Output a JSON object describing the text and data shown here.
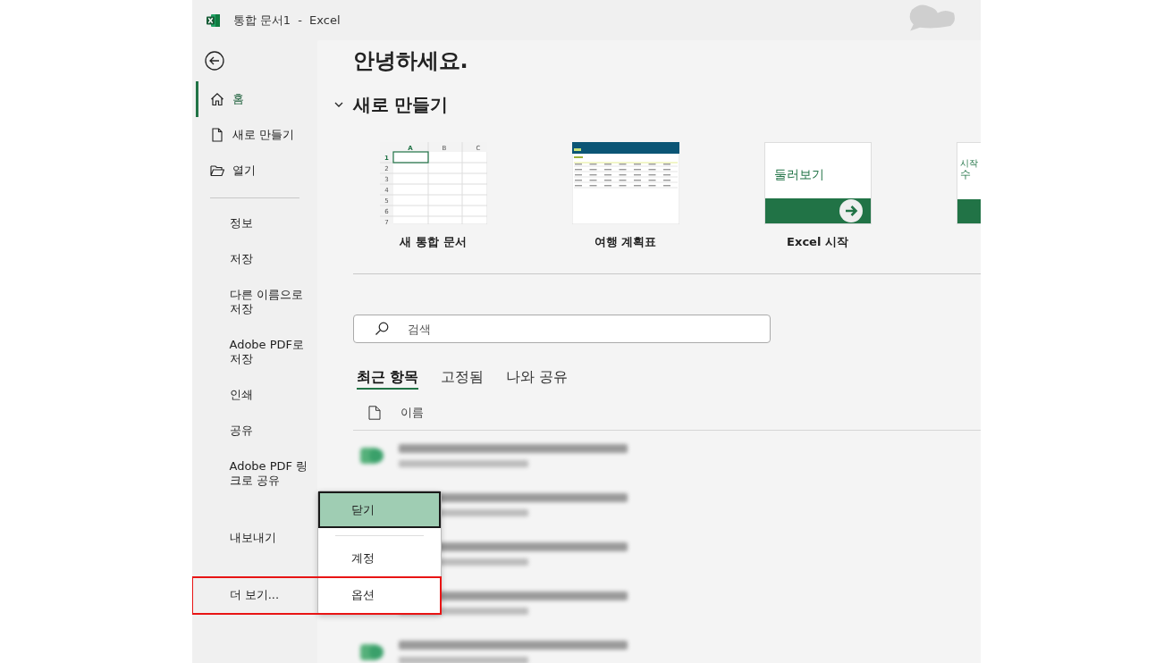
{
  "window": {
    "title": "통합 문서1  -  Excel"
  },
  "sidebar": {
    "nav": [
      {
        "label": "홈",
        "kind": "home",
        "selected": true
      },
      {
        "label": "새로 만들기",
        "kind": "new",
        "selected": false
      },
      {
        "label": "열기",
        "kind": "open",
        "selected": false
      }
    ],
    "items": [
      {
        "label": "정보"
      },
      {
        "label": "저장"
      },
      {
        "label": "다른 이름으로 저장"
      },
      {
        "label": "Adobe PDF로 저장"
      },
      {
        "label": "인쇄"
      },
      {
        "label": "공유"
      },
      {
        "label": "Adobe PDF 링크로 공유"
      }
    ],
    "bottom_items": [
      {
        "label": "내보내기"
      },
      {
        "label": "더 보기...",
        "highlighted": true
      }
    ]
  },
  "greeting": "안녕하세요.",
  "new_section": {
    "title": "새로 만들기",
    "expanded": true,
    "templates": [
      {
        "kind": "blank",
        "label": "새 통합 문서",
        "columns": [
          "A",
          "B",
          "C"
        ],
        "rows": [
          "1",
          "2",
          "3",
          "4",
          "5",
          "6",
          "7"
        ]
      },
      {
        "kind": "planner",
        "label": "여행 계획표"
      },
      {
        "kind": "tour",
        "label": "Excel 시작",
        "card_text": "둘러보기"
      },
      {
        "kind": "partial",
        "lines": [
          "시작",
          "수"
        ]
      }
    ]
  },
  "search": {
    "placeholder": "검색"
  },
  "tabs": [
    {
      "label": "최근 항목",
      "selected": true
    },
    {
      "label": "고정됨",
      "selected": false
    },
    {
      "label": "나와 공유",
      "selected": false
    }
  ],
  "file_list": {
    "column": "이름",
    "rows": [
      {
        "kind": "blurred",
        "icon": true
      },
      {
        "kind": "blurred",
        "icon": false
      },
      {
        "kind": "blurred",
        "icon": false
      },
      {
        "kind": "blurred",
        "icon": false
      },
      {
        "kind": "blurred",
        "icon": true
      }
    ]
  },
  "more_menu": {
    "items": [
      {
        "label": "닫기",
        "selected": true
      },
      {
        "label": "계정",
        "selected": false
      },
      {
        "label": "옵션",
        "selected": false
      }
    ]
  }
}
